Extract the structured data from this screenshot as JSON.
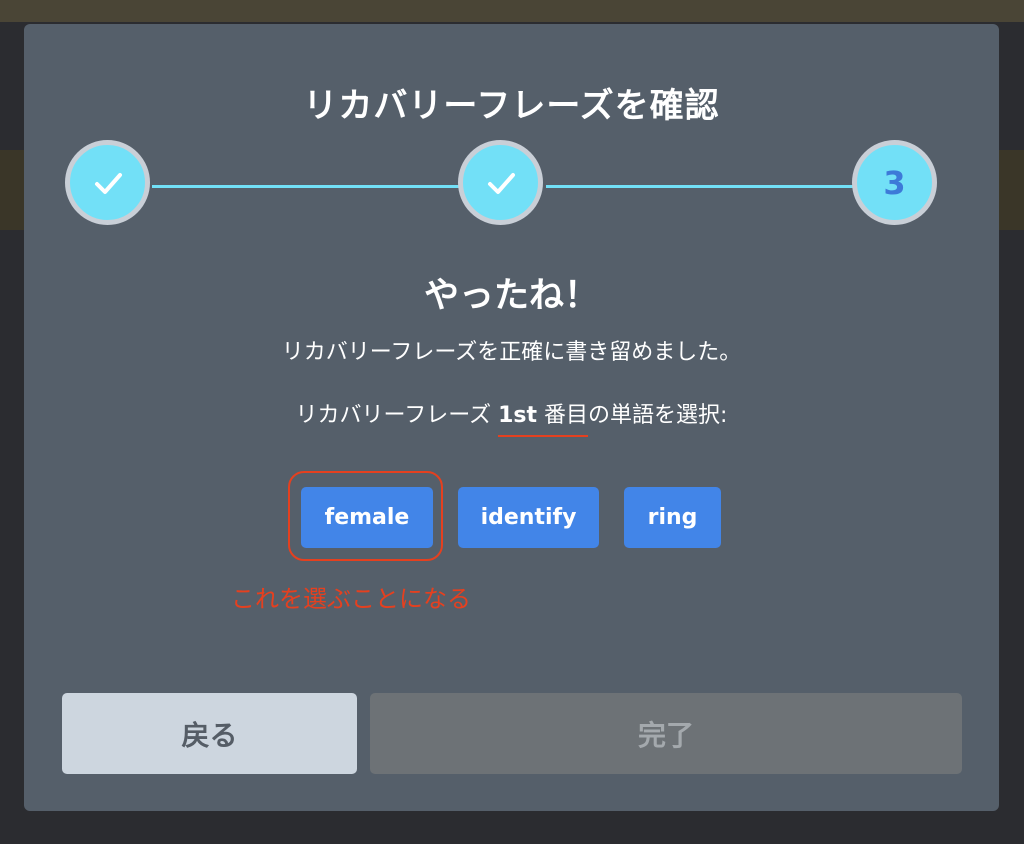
{
  "dialog": {
    "title": "リカバリーフレーズを確認"
  },
  "stepper": {
    "steps": [
      {
        "state": "complete",
        "icon": "checkmark-icon"
      },
      {
        "state": "complete",
        "icon": "checkmark-icon"
      },
      {
        "state": "current",
        "label": "3"
      }
    ],
    "colors": {
      "active": "#72e0f7",
      "ring": "#c9cfd7",
      "number": "#3d7ad8"
    }
  },
  "content": {
    "heading": "やったね！",
    "message": "リカバリーフレーズを正確に書き留めました。",
    "instruction_prefix": "リカバリーフレーズ ",
    "instruction_ordinal": "1st",
    "instruction_counter": " 番目",
    "instruction_suffix": "の単語を選択:"
  },
  "word_options": [
    "female",
    "identify",
    "ring"
  ],
  "annotation": {
    "text": "これを選ぶことになる",
    "color": "#e5401f"
  },
  "footer": {
    "back_label": "戻る",
    "done_label": "完了"
  },
  "colors": {
    "dialog_bg": "#555f6a",
    "word_button": "#4285e8",
    "back_button": "#cdd6df",
    "done_button_disabled": "#6d7276"
  }
}
